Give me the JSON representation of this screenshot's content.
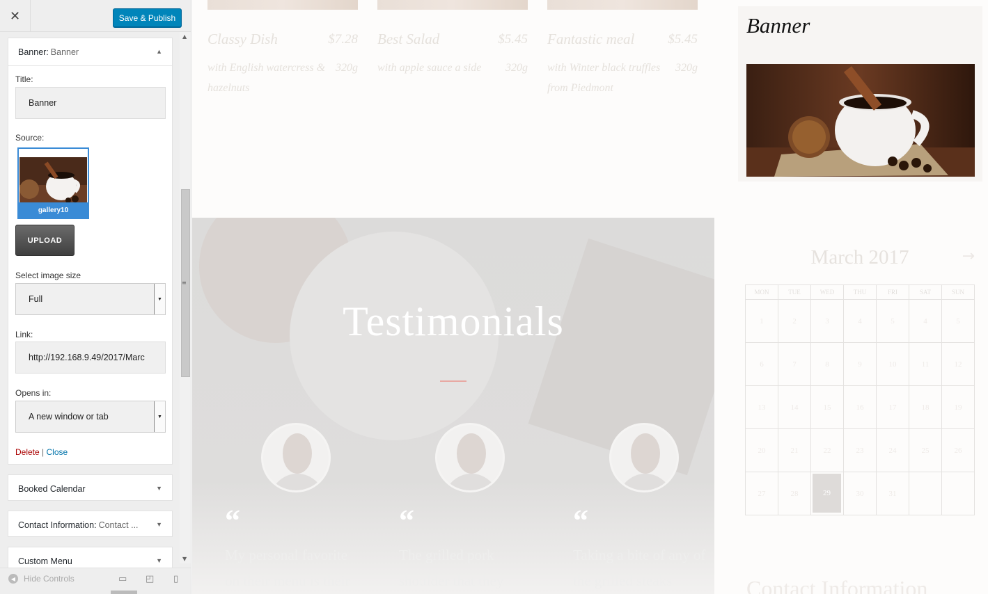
{
  "customizer": {
    "close_icon": "close-icon",
    "publish_label": "Save & Publish",
    "banner_widget": {
      "type": "Banner:",
      "name": "Banner",
      "title_label": "Title:",
      "title_value": "Banner",
      "source_label": "Source:",
      "source_caption": "gallery10",
      "upload_label": "UPLOAD",
      "size_label": "Select image size",
      "size_value": "Full",
      "link_label": "Link:",
      "link_value": "http://192.168.9.49/2017/Marc",
      "opens_label": "Opens in:",
      "opens_value": "A new window or tab",
      "delete_label": "Delete",
      "separator": "|",
      "close_label": "Close"
    },
    "widgets": [
      {
        "type": "Booked Calendar",
        "sub": ""
      },
      {
        "type": "Contact Information:",
        "sub": "Contact ..."
      },
      {
        "type": "Custom Menu",
        "sub": ""
      }
    ],
    "footer": {
      "hide_label": "Hide Controls"
    }
  },
  "preview": {
    "menu": [
      {
        "name": "Classy Dish",
        "price": "$7.28",
        "desc": "with English watercress & hazelnuts",
        "weight": "320g"
      },
      {
        "name": "Best Salad",
        "price": "$5.45",
        "desc": "with apple sauce a side",
        "weight": "320g"
      },
      {
        "name": "Fantastic meal",
        "price": "$5.45",
        "desc": "with Winter black truffles from Piedmont",
        "weight": "320g"
      }
    ],
    "testimonials": {
      "title": "Testimonials",
      "quote_mark": "“",
      "items": [
        {
          "text": "My personal favorite on their menu is their"
        },
        {
          "text": "The grilled pork shoulder that they"
        },
        {
          "text": "Taking a bite of any of the grilled steaks"
        }
      ]
    },
    "banner": {
      "title": "Banner"
    },
    "calendar": {
      "title": "March 2017",
      "next_icon": "arrow-right-icon",
      "weekdays": [
        "MON",
        "TUE",
        "WED",
        "THU",
        "FRI",
        "SAT",
        "SUN"
      ],
      "weeks": [
        [
          "1",
          "2",
          "3",
          "4",
          "5",
          "4",
          "5"
        ],
        [
          "6",
          "7",
          "8",
          "9",
          "10",
          "11",
          "12"
        ],
        [
          "13",
          "14",
          "15",
          "16",
          "17",
          "18",
          "19"
        ],
        [
          "20",
          "21",
          "22",
          "23",
          "24",
          "25",
          "26"
        ],
        [
          "27",
          "28",
          "29",
          "30",
          "31",
          "",
          ""
        ]
      ],
      "today": "29"
    },
    "next_section_title": "Contact Information"
  },
  "colors": {
    "publish": "#0085ba",
    "selected_image": "#3a8bd6",
    "delete_link": "#aa0000",
    "close_link": "#0073aa"
  }
}
